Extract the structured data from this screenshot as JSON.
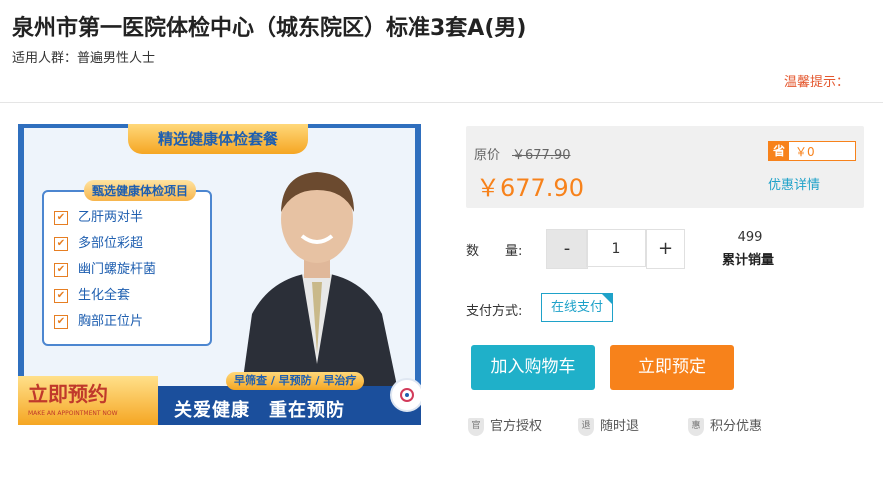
{
  "header": {
    "title": "泉州市第一医院体检中心（城东院区）标准3套A(男)",
    "audience": "适用人群：普遍男性人士",
    "notice": "温馨提示："
  },
  "image": {
    "banner_top": "精选健康体检套餐",
    "checklist_title": "甄选健康体检项目",
    "checklist": [
      "乙肝两对半",
      "多部位彩超",
      "幽门螺旋杆菌",
      "生化全套",
      "胸部正位片"
    ],
    "appointment_main": "立即预约",
    "appointment_sub": "MAKE AN APPOINTMENT NOW",
    "early_tagline": "早筛查 / 早预防 / 早治疗",
    "slogan": "关爱健康　重在预防"
  },
  "price": {
    "original_label": "原价",
    "original_value": "￥677.90",
    "current": "￥677.90",
    "save_tag": "省",
    "save_value": "￥0",
    "discount_link": "优惠详情"
  },
  "quantity": {
    "label": "数　　量:",
    "minus": "-",
    "value": "1",
    "plus": "+"
  },
  "sales": {
    "count": "499",
    "label": "累计销量"
  },
  "payment": {
    "label": "支付方式:",
    "option": "在线支付"
  },
  "actions": {
    "add_cart": "加入购物车",
    "book_now": "立即预定"
  },
  "assurances": [
    {
      "icon": "官",
      "label": "官方授权"
    },
    {
      "icon": "退",
      "label": "随时退"
    },
    {
      "icon": "惠",
      "label": "积分优惠"
    }
  ],
  "colors": {
    "accent_orange": "#f7821b",
    "accent_cyan": "#1fb0c9",
    "banner_blue": "#1b4f9c"
  }
}
